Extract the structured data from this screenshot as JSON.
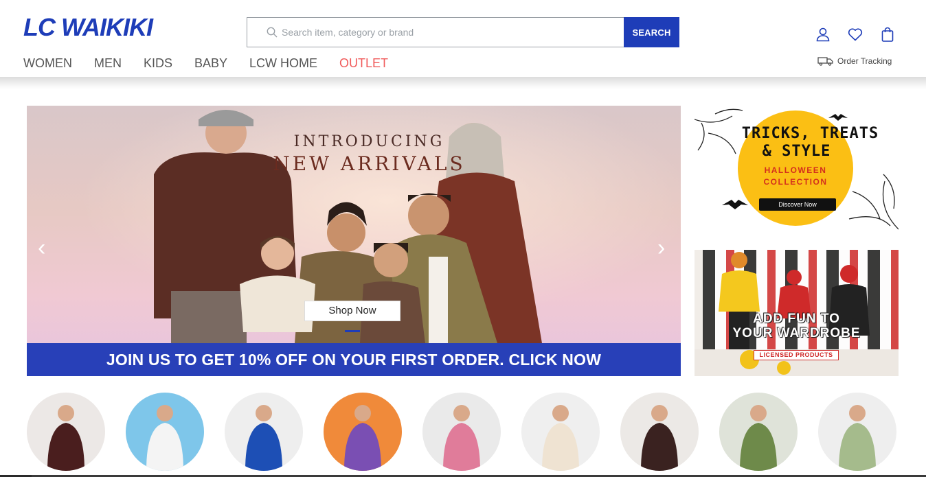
{
  "brand": {
    "logo_text": "LC WAIKIKI",
    "accent_color": "#1e3db8"
  },
  "search": {
    "placeholder": "Search item, category or brand",
    "button_label": "SEARCH"
  },
  "nav": {
    "items": [
      {
        "label": "WOMEN"
      },
      {
        "label": "MEN"
      },
      {
        "label": "KIDS"
      },
      {
        "label": "BABY"
      },
      {
        "label": "LCW HOME"
      },
      {
        "label": "OUTLET",
        "highlight_color": "#f05a5a"
      }
    ]
  },
  "header_icons": [
    "user-icon",
    "heart-icon",
    "bag-icon"
  ],
  "order_tracking": {
    "label": "Order Tracking",
    "icon": "truck-icon"
  },
  "hero": {
    "title_line1": "INTRODUCING",
    "title_line2": "NEW ARRIVALS",
    "cta_label": "Shop Now",
    "prev_icon": "chevron-left-icon",
    "next_icon": "chevron-right-icon",
    "slide_count": 2,
    "active_slide": 1
  },
  "promo_bar": {
    "text": "JOIN US TO GET 10% OFF ON YOUR FIRST ORDER. CLICK NOW",
    "color": "#2840b8"
  },
  "side_banners": {
    "halloween": {
      "line1": "TRICKS, TREATS",
      "line2": "& STYLE",
      "sub1": "HALLOWEEN",
      "sub2": "COLLECTION",
      "button_label": "Discover Now",
      "circle_color": "#fbbf14"
    },
    "wardrobe": {
      "line1": "ADD FUN TO",
      "line2": "YOUR WARDROBE",
      "badge": "LICENSED PRODUCTS"
    }
  },
  "categories": [
    {
      "name": "women",
      "bg": "#ece8e6",
      "fg": "#4a1e1e"
    },
    {
      "name": "women-knit",
      "bg": "#7ec6ea",
      "fg": "#f4f4f4"
    },
    {
      "name": "men",
      "bg": "#eeeeee",
      "fg": "#1d4fb5"
    },
    {
      "name": "kids",
      "bg": "#f08a3a",
      "fg": "#7a4fb3"
    },
    {
      "name": "girls",
      "bg": "#eaeaea",
      "fg": "#e07c9a"
    },
    {
      "name": "boys-baby",
      "bg": "#efefef",
      "fg": "#efe3d2"
    },
    {
      "name": "maternity",
      "bg": "#ece9e6",
      "fg": "#3a2220"
    },
    {
      "name": "baby-girl",
      "bg": "#dfe3d9",
      "fg": "#6e8a4a"
    },
    {
      "name": "baby-boy",
      "bg": "#eeeeee",
      "fg": "#a5bb8c"
    }
  ]
}
